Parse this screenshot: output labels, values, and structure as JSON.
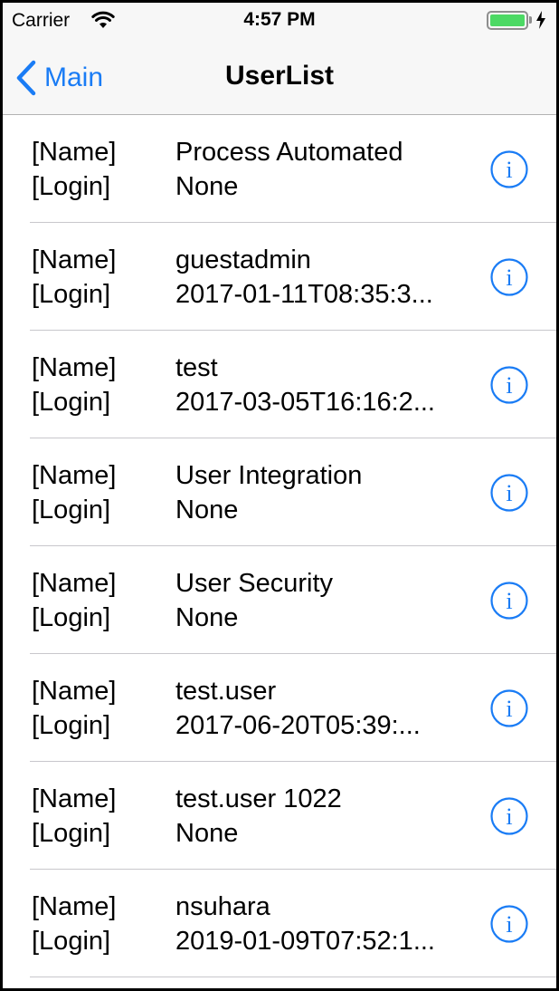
{
  "status_bar": {
    "carrier": "Carrier",
    "time": "4:57 PM",
    "battery_level": 1.0,
    "battery_color": "#4cd964",
    "icons": [
      "wifi-icon",
      "battery-icon",
      "charging-bolt-icon"
    ]
  },
  "nav": {
    "back_label": "Main",
    "title": "UserList",
    "accent_color": "#1a7cf5"
  },
  "rows": [
    {
      "name_label": "[Name]",
      "login_label": "[Login]",
      "name": "Process Automated",
      "login": "None"
    },
    {
      "name_label": "[Name]",
      "login_label": "[Login]",
      "name": "guestadmin",
      "login": "2017-01-11T08:35:3..."
    },
    {
      "name_label": "[Name]",
      "login_label": "[Login]",
      "name": "test",
      "login": "2017-03-05T16:16:2..."
    },
    {
      "name_label": "[Name]",
      "login_label": "[Login]",
      "name": "User Integration",
      "login": "None"
    },
    {
      "name_label": "[Name]",
      "login_label": "[Login]",
      "name": "User Security",
      "login": "None"
    },
    {
      "name_label": "[Name]",
      "login_label": "[Login]",
      "name": "test.user",
      "login": "2017-06-20T05:39:..."
    },
    {
      "name_label": "[Name]",
      "login_label": "[Login]",
      "name": "test.user 1022",
      "login": "None"
    },
    {
      "name_label": "[Name]",
      "login_label": "[Login]",
      "name": "nsuhara",
      "login": "2019-01-09T07:52:1..."
    }
  ]
}
